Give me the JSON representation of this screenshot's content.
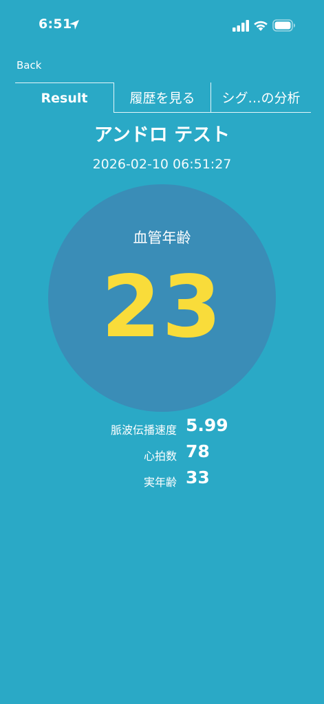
{
  "status_bar": {
    "time": "6:51",
    "icons": [
      "location-arrow-icon",
      "cellular-signal-icon",
      "wifi-icon",
      "battery-icon"
    ]
  },
  "nav": {
    "back_label": "Back"
  },
  "tabs": [
    {
      "label": "Result",
      "selected": true
    },
    {
      "label": "履歴を見る",
      "selected": false
    },
    {
      "label": "シグ…の分析",
      "selected": false
    }
  ],
  "result": {
    "title": "アンドロ テスト",
    "timestamp": "2026-02-10 06:51:27",
    "vascular_age_label": "血管年齢",
    "vascular_age_value": "23"
  },
  "stats": [
    {
      "label": "脈波伝播速度",
      "value": "5.99"
    },
    {
      "label": "心拍数",
      "value": "78"
    },
    {
      "label": "実年齢",
      "value": "33"
    }
  ],
  "colors": {
    "background": "#2aa9c6",
    "circle": "#3a8db7",
    "age_value": "#f9dc3a",
    "text": "#ffffff"
  }
}
